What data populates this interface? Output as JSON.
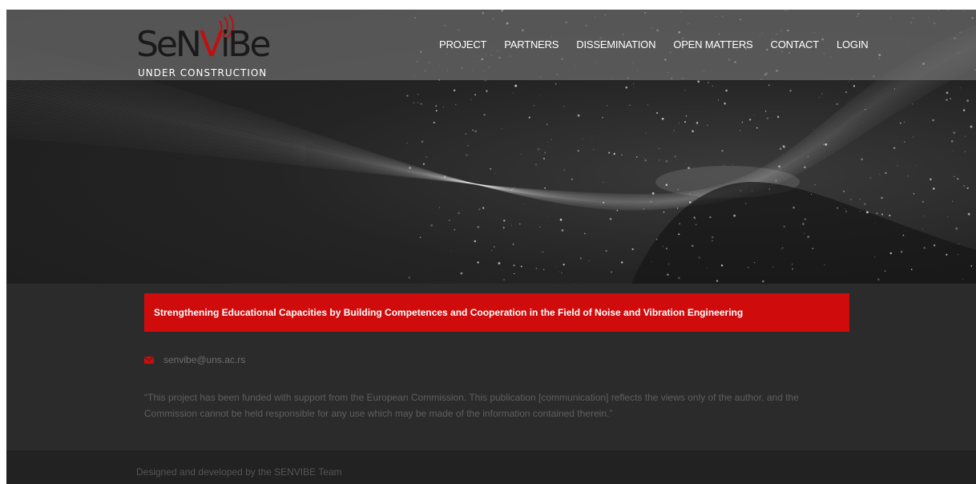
{
  "brand": {
    "logo_text_left": "SeN",
    "logo_text_mid": "V",
    "logo_text_right": "iBe",
    "tagline": "UNDER CONSTRUCTION",
    "accent_color": "#d00b0b"
  },
  "nav": {
    "items": [
      {
        "label": "PROJECT"
      },
      {
        "label": "PARTNERS"
      },
      {
        "label": "DISSEMINATION"
      },
      {
        "label": "OPEN MATTERS"
      },
      {
        "label": "CONTACT"
      },
      {
        "label": "LOGIN"
      }
    ]
  },
  "banner": {
    "text": "Strengthening Educational Capacities by Building Competences and Cooperation in the Field of Noise and Vibration Engineering"
  },
  "contact": {
    "icon": "mail-icon",
    "email": "senvibe@uns.ac.rs"
  },
  "disclaimer": {
    "text": "“This project has been funded with support from the European Commission. This publication [communication] reflects the views only of the author, and the Commission cannot be held responsible for any use which may be made of the information contained therein.”"
  },
  "footer": {
    "credit": "Designed and developed by the SENVIBE Team"
  }
}
